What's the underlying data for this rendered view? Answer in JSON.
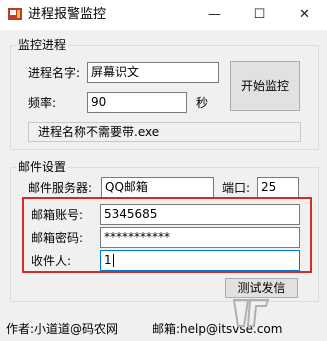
{
  "window": {
    "title": "进程报警监控",
    "icon": "app-icon",
    "controls": {
      "minimize": "—",
      "maximize": "☐",
      "close": "✕"
    }
  },
  "monitor": {
    "legend": "监控进程",
    "process_label": "进程名字:",
    "process_value": "屏幕识文",
    "freq_label": "频率:",
    "freq_value": "90",
    "freq_unit": "秒",
    "start_button": "开始监控",
    "hint": "进程名称不需要带.exe"
  },
  "mail": {
    "legend": "邮件设置",
    "server_label": "邮件服务器:",
    "server_value": "QQ邮箱",
    "port_label": "端口:",
    "port_value": "25",
    "account_label": "邮箱账号:",
    "account_value": "5345685",
    "password_label": "邮箱密码:",
    "password_value": "***********",
    "recipient_label": "收件人:",
    "recipient_value": "1",
    "test_button": "测试发信"
  },
  "footer": {
    "author": "作者:小道道@码农网",
    "email": "邮箱:help@itsvse.com"
  },
  "colors": {
    "highlight_border": "#d32a2a",
    "window_bg": "#f0f0f0",
    "titlebar_bg": "#ffffff"
  }
}
